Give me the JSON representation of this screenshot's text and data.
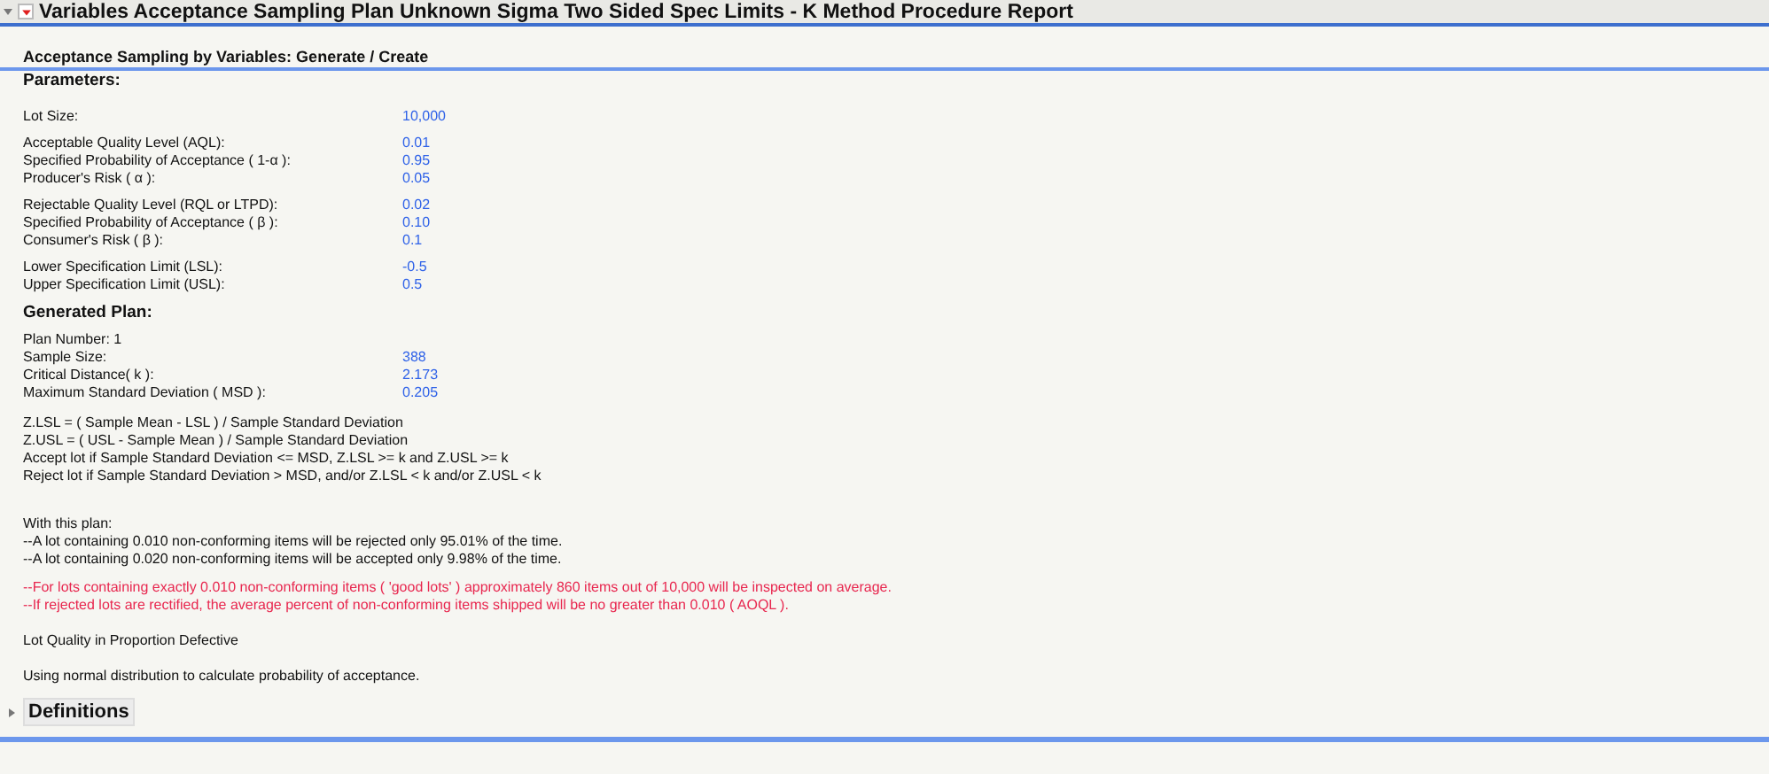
{
  "report": {
    "title": "Variables Acceptance Sampling Plan Unknown Sigma Two Sided Spec Limits - K Method Procedure Report",
    "expanded": true
  },
  "section": {
    "title": "Acceptance Sampling by Variables: Generate / Create"
  },
  "parameters": {
    "heading": "Parameters:",
    "groups": [
      [
        {
          "label": "Lot Size:",
          "value": "10,000"
        }
      ],
      [
        {
          "label": "Acceptable Quality Level (AQL):",
          "value": "0.01"
        },
        {
          "label": "Specified Probability of Acceptance ( 1-α ):",
          "value": "0.95"
        },
        {
          "label": "Producer's Risk ( α ):",
          "value": "0.05"
        }
      ],
      [
        {
          "label": "Rejectable Quality Level (RQL or LTPD):",
          "value": "0.02"
        },
        {
          "label": "Specified Probability of Acceptance ( β ):",
          "value": "0.10"
        },
        {
          "label": "Consumer's Risk ( β ):",
          "value": "0.1"
        }
      ],
      [
        {
          "label": "Lower Specification Limit (LSL):",
          "value": "-0.5"
        },
        {
          "label": "Upper Specification Limit (USL):",
          "value": "0.5"
        }
      ]
    ]
  },
  "plan": {
    "heading": "Generated Plan:",
    "plan_number": "Plan Number: 1",
    "rows": [
      {
        "label": "Sample Size:",
        "value": "388"
      },
      {
        "label": "Critical Distance( k ):",
        "value": "2.173"
      },
      {
        "label": "Maximum Standard Deviation ( MSD ):",
        "value": "0.205"
      }
    ],
    "formulas": [
      "Z.LSL = ( Sample Mean - LSL ) / Sample Standard Deviation",
      "Z.USL = ( USL - Sample Mean ) / Sample Standard Deviation",
      "Accept lot if Sample Standard Deviation <= MSD, Z.LSL >= k and Z.USL >= k",
      "Reject lot if Sample Standard Deviation > MSD, and/or Z.LSL < k and/or Z.USL < k"
    ],
    "summary": [
      "With this plan:",
      "--A lot containing 0.010 non-conforming items will be rejected only 95.01% of the time.",
      "--A lot containing 0.020 non-conforming items will be accepted only 9.98% of the time."
    ],
    "warnings": [
      "--For lots containing exactly 0.010 non-conforming items ( 'good lots' ) approximately 860 items out of 10,000 will be inspected on average.",
      "--If rejected lots are rectified, the average percent of non-conforming items shipped will be no greater than 0.010 ( AOQL )."
    ],
    "notes": [
      "Lot Quality in Proportion Defective",
      "Using normal distribution to calculate probability of acceptance."
    ]
  },
  "definitions": {
    "title": "Definitions",
    "expanded": false
  }
}
